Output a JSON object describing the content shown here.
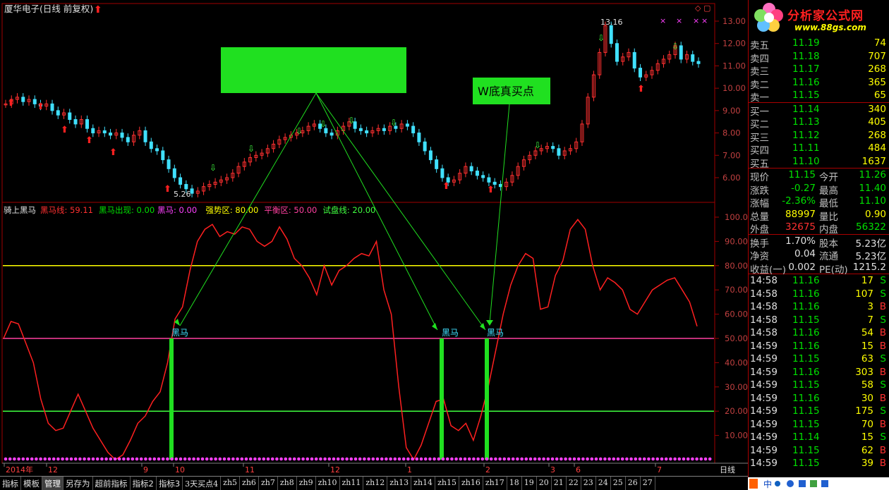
{
  "window_title": "厦华电子(日线 前复权)",
  "indicator_title": "骑上黑马",
  "indicator_params": [
    {
      "label": "黑马线: 59.11",
      "color": "#ff3030"
    },
    {
      "label": "黑马出现: 0.00",
      "color": "#00e000"
    },
    {
      "label": "黑马: 0.00",
      "color": "#ff40ff"
    },
    {
      "label": "强势区: 80.00",
      "color": "#ffff00"
    },
    {
      "label": "平衡区: 50.00",
      "color": "#ff40a0"
    },
    {
      "label": "试盘线: 20.00",
      "color": "#40ff40"
    }
  ],
  "annotation_label": "W底真买点",
  "price_axis_labels": [
    "13.00",
    "12.00",
    "11.00",
    "10.00",
    "9.00",
    "8.00",
    "7.00",
    "6.00"
  ],
  "indicator_axis_labels": [
    "100.0",
    "90.00",
    "80.00",
    "70.00",
    "60.00",
    "50.00",
    "40.00",
    "30.00",
    "20.00",
    "10.00"
  ],
  "price_high_label": "13.16",
  "price_low_label": "5.26",
  "heima_signal_label": "黑马",
  "date_axis_labels": [
    "2014年",
    "12",
    "9",
    "10",
    "11",
    "12",
    "1",
    "2",
    "3",
    "6",
    "7"
  ],
  "period_label": "日线",
  "bottom_tabs": [
    "指标",
    "模板",
    "管理",
    "另存为",
    "超前指标",
    "指标2",
    "指标3",
    "3天买点4",
    "zh5",
    "zh6",
    "zh7",
    "zh8",
    "zh9",
    "zh10",
    "zh11",
    "zh12",
    "zh13",
    "zh14",
    "zh15",
    "zh16",
    "zh17",
    "18",
    "19",
    "20",
    "21",
    "22",
    "23",
    "24",
    "25",
    "26",
    "27"
  ],
  "quote": {
    "logo_text": "分析家公式网",
    "logo_url": "www.88gs.com",
    "asks": [
      {
        "label": "卖五",
        "price": "11.19",
        "vol": "74"
      },
      {
        "label": "卖四",
        "price": "11.18",
        "vol": "707"
      },
      {
        "label": "卖三",
        "price": "11.17",
        "vol": "268"
      },
      {
        "label": "卖二",
        "price": "11.16",
        "vol": "365"
      },
      {
        "label": "卖一",
        "price": "11.15",
        "vol": "65"
      }
    ],
    "bids": [
      {
        "label": "买一",
        "price": "11.14",
        "vol": "340"
      },
      {
        "label": "买二",
        "price": "11.13",
        "vol": "405"
      },
      {
        "label": "买三",
        "price": "11.12",
        "vol": "268"
      },
      {
        "label": "买四",
        "price": "11.11",
        "vol": "484"
      },
      {
        "label": "买五",
        "price": "11.10",
        "vol": "1637"
      }
    ],
    "stats": [
      {
        "l1": "现价",
        "v1": "11.15",
        "c1": "grn",
        "l2": "今开",
        "v2": "11.26",
        "c2": "grn"
      },
      {
        "l1": "涨跌",
        "v1": "-0.27",
        "c1": "grn",
        "l2": "最高",
        "v2": "11.40",
        "c2": "grn"
      },
      {
        "l1": "涨幅",
        "v1": "-2.36%",
        "c1": "grn",
        "l2": "最低",
        "v2": "11.10",
        "c2": "grn"
      },
      {
        "l1": "总量",
        "v1": "88997",
        "c1": "yel",
        "l2": "量比",
        "v2": "0.90",
        "c2": "yel"
      },
      {
        "l1": "外盘",
        "v1": "32675",
        "c1": "red",
        "l2": "内盘",
        "v2": "56322",
        "c2": "grn"
      }
    ],
    "stats2": [
      {
        "l1": "换手",
        "v1": "1.70%",
        "l2": "股本",
        "v2": "5.23亿"
      },
      {
        "l1": "净资",
        "v1": "0.04",
        "l2": "流通",
        "v2": "5.23亿"
      },
      {
        "l1": "收益(一)",
        "v1": "0.002",
        "l2": "PE(动)",
        "v2": "1215.2"
      }
    ],
    "ticks": [
      {
        "t": "14:58",
        "p": "11.16",
        "v": "17",
        "s": "S"
      },
      {
        "t": "14:58",
        "p": "11.16",
        "v": "107",
        "s": "S"
      },
      {
        "t": "14:58",
        "p": "11.16",
        "v": "3",
        "s": "B"
      },
      {
        "t": "14:58",
        "p": "11.15",
        "v": "7",
        "s": "S"
      },
      {
        "t": "14:58",
        "p": "11.16",
        "v": "54",
        "s": "B"
      },
      {
        "t": "14:59",
        "p": "11.16",
        "v": "15",
        "s": "B"
      },
      {
        "t": "14:59",
        "p": "11.15",
        "v": "63",
        "s": "S"
      },
      {
        "t": "14:59",
        "p": "11.16",
        "v": "303",
        "s": "B"
      },
      {
        "t": "14:59",
        "p": "11.15",
        "v": "58",
        "s": "S"
      },
      {
        "t": "14:59",
        "p": "11.16",
        "v": "30",
        "s": "B"
      },
      {
        "t": "14:59",
        "p": "11.15",
        "v": "175",
        "s": "S"
      },
      {
        "t": "14:59",
        "p": "11.15",
        "v": "70",
        "s": "B"
      },
      {
        "t": "14:59",
        "p": "11.14",
        "v": "15",
        "s": "S"
      },
      {
        "t": "14:59",
        "p": "11.15",
        "v": "62",
        "s": "B"
      },
      {
        "t": "14:59",
        "p": "11.15",
        "v": "39",
        "s": "B"
      }
    ]
  },
  "chart_data": [
    {
      "type": "candlestick",
      "title": "厦华电子(日线 前复权)",
      "ylim": [
        5.0,
        13.5
      ],
      "closes": [
        9.3,
        9.5,
        9.6,
        9.4,
        9.5,
        9.3,
        9.2,
        9.3,
        9.0,
        8.8,
        8.9,
        8.6,
        8.4,
        8.6,
        8.2,
        8.0,
        8.1,
        8.0,
        7.9,
        8.0,
        7.8,
        7.6,
        7.9,
        8.1,
        7.6,
        7.3,
        7.2,
        6.8,
        6.4,
        6.0,
        5.7,
        5.5,
        5.3,
        5.4,
        5.6,
        5.7,
        5.8,
        5.9,
        6.0,
        6.2,
        6.5,
        6.7,
        6.9,
        7.0,
        7.1,
        7.3,
        7.5,
        7.7,
        7.8,
        7.9,
        8.0,
        8.1,
        8.3,
        8.4,
        8.2,
        8.0,
        7.9,
        8.1,
        8.3,
        8.5,
        8.2,
        8.1,
        8.0,
        8.1,
        8.2,
        8.1,
        8.3,
        8.2,
        8.4,
        8.3,
        8.0,
        7.6,
        7.2,
        6.8,
        6.4,
        6.0,
        5.8,
        5.9,
        6.2,
        6.5,
        6.3,
        6.1,
        6.0,
        5.8,
        5.7,
        5.6,
        5.8,
        6.1,
        6.5,
        6.8,
        7.0,
        7.2,
        7.3,
        7.4,
        7.3,
        7.0,
        7.2,
        7.3,
        7.6,
        8.4,
        9.6,
        10.6,
        11.6,
        12.8,
        12.0,
        11.2,
        11.4,
        11.6,
        10.9,
        10.5,
        10.6,
        10.8,
        11.1,
        11.3,
        11.5,
        11.9,
        11.3,
        11.5,
        11.2,
        11.1
      ],
      "high_label": "13.16",
      "low_label": "5.26"
    },
    {
      "type": "line",
      "title": "骑上黑马",
      "ylim": [
        0,
        105
      ],
      "series": [
        {
          "name": "黑马线",
          "values": [
            50,
            57,
            56,
            48,
            40,
            25,
            15,
            12,
            13,
            20,
            27,
            20,
            13,
            8,
            3,
            0,
            2,
            8,
            15,
            18,
            24,
            28,
            40,
            58,
            63,
            78,
            90,
            95,
            97,
            92,
            94,
            93,
            96,
            95,
            90,
            88,
            90,
            96,
            91,
            83,
            80,
            75,
            68,
            80,
            72,
            78,
            80,
            83,
            85,
            84,
            90,
            70,
            60,
            30,
            5,
            0,
            6,
            15,
            24,
            25,
            14,
            12,
            15,
            8,
            18,
            30,
            45,
            60,
            72,
            80,
            85,
            83,
            62,
            63,
            76,
            82,
            95,
            99,
            95,
            80,
            70,
            75,
            73,
            70,
            62,
            60,
            65,
            70,
            72,
            74,
            75,
            70,
            65,
            55
          ]
        }
      ],
      "hlines": [
        {
          "name": "强势区",
          "value": 80
        },
        {
          "name": "平衡区",
          "value": 50
        },
        {
          "name": "试盘线",
          "value": 20
        }
      ]
    }
  ]
}
